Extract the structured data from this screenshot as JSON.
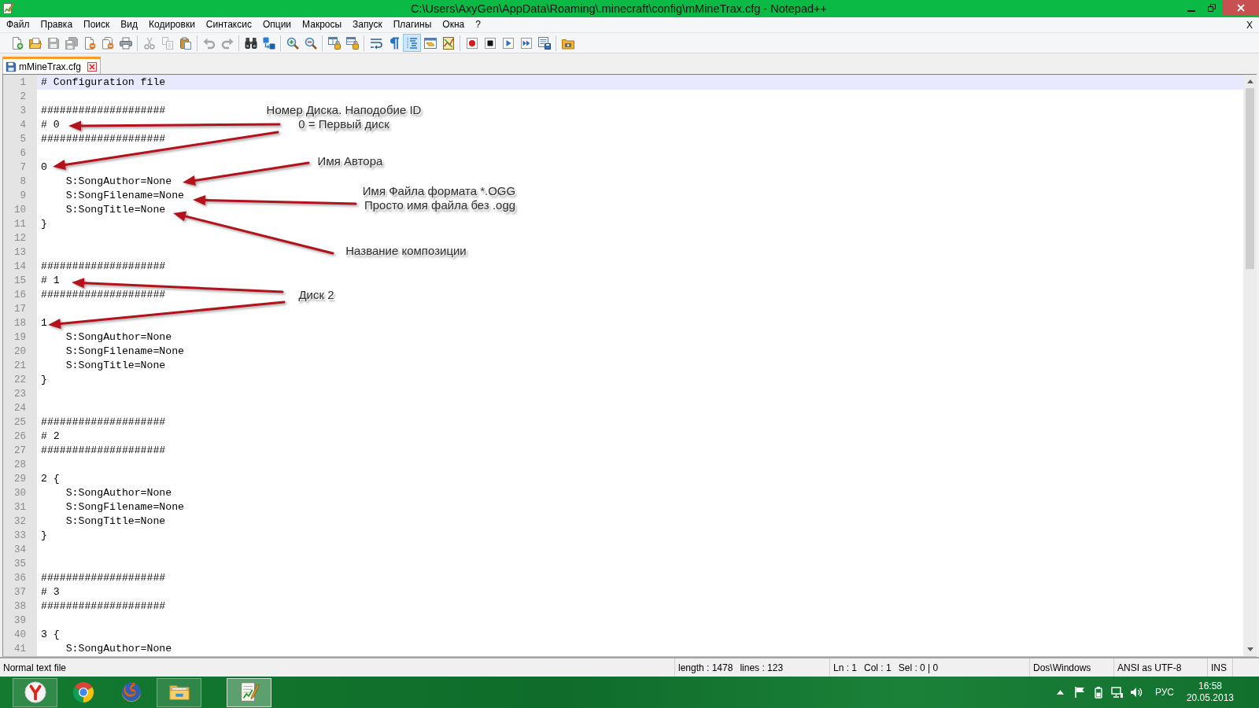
{
  "window": {
    "title": "C:\\Users\\AxyGen\\AppData\\Roaming\\.minecraft\\config\\mMineTrax.cfg - Notepad++"
  },
  "menu": [
    "Файл",
    "Правка",
    "Поиск",
    "Вид",
    "Кодировки",
    "Синтаксис",
    "Опции",
    "Макросы",
    "Запуск",
    "Плагины",
    "Окна",
    "?"
  ],
  "menu_close": "X",
  "toolbar": [
    [
      {
        "kind": "new",
        "disabled": false,
        "pressed": false
      },
      {
        "kind": "open",
        "disabled": false,
        "pressed": false
      },
      {
        "kind": "save",
        "disabled": true,
        "pressed": false
      },
      {
        "kind": "save_all",
        "disabled": true,
        "pressed": false
      },
      {
        "kind": "close",
        "disabled": false,
        "pressed": false
      },
      {
        "kind": "close_all",
        "disabled": false,
        "pressed": false
      },
      {
        "kind": "print",
        "disabled": false,
        "pressed": false
      }
    ],
    [
      {
        "kind": "cut",
        "disabled": true,
        "pressed": false
      },
      {
        "kind": "copy",
        "disabled": true,
        "pressed": false
      },
      {
        "kind": "paste",
        "disabled": false,
        "pressed": false
      }
    ],
    [
      {
        "kind": "undo",
        "disabled": true,
        "pressed": false
      },
      {
        "kind": "redo",
        "disabled": true,
        "pressed": false
      }
    ],
    [
      {
        "kind": "find",
        "disabled": false,
        "pressed": false
      },
      {
        "kind": "replace",
        "disabled": false,
        "pressed": false
      }
    ],
    [
      {
        "kind": "zoom_in",
        "disabled": false,
        "pressed": false
      },
      {
        "kind": "zoom_out",
        "disabled": false,
        "pressed": false
      }
    ],
    [
      {
        "kind": "sync_v",
        "disabled": false,
        "pressed": false
      },
      {
        "kind": "sync_h",
        "disabled": false,
        "pressed": false
      }
    ],
    [
      {
        "kind": "wrap",
        "disabled": false,
        "pressed": false
      },
      {
        "kind": "all_chars",
        "disabled": false,
        "pressed": false
      },
      {
        "kind": "indent_guide",
        "disabled": false,
        "pressed": true
      },
      {
        "kind": "udl",
        "disabled": false,
        "pressed": false
      },
      {
        "kind": "doc_map",
        "disabled": false,
        "pressed": false
      }
    ],
    [
      {
        "kind": "record",
        "disabled": false,
        "pressed": false
      },
      {
        "kind": "stop",
        "disabled": false,
        "pressed": false
      },
      {
        "kind": "play",
        "disabled": false,
        "pressed": false
      },
      {
        "kind": "play_multi",
        "disabled": false,
        "pressed": false
      },
      {
        "kind": "save_macro",
        "disabled": false,
        "pressed": false
      }
    ],
    [
      {
        "kind": "folder",
        "disabled": false,
        "pressed": false
      }
    ]
  ],
  "tabs": [
    {
      "label": "mMineTrax.cfg",
      "selected": true
    }
  ],
  "editor": {
    "lines": [
      {
        "number": "1",
        "text": "# Configuration file",
        "current": true
      },
      {
        "number": "2",
        "current": false
      },
      {
        "number": "3",
        "text": "####################",
        "current": false
      },
      {
        "number": "4",
        "text": "# 0",
        "current": false
      },
      {
        "number": "5",
        "text": "####################",
        "current": false
      },
      {
        "number": "6",
        "current": false
      },
      {
        "number": "7",
        "text": "0",
        "current": false
      },
      {
        "number": "8",
        "text": "    S:SongAuthor=None",
        "current": false
      },
      {
        "number": "9",
        "text": "    S:SongFilename=None",
        "current": false
      },
      {
        "number": "10",
        "text": "    S:SongTitle=None",
        "current": false
      },
      {
        "number": "11",
        "text": "}",
        "current": false
      },
      {
        "number": "12",
        "current": false
      },
      {
        "number": "13",
        "current": false
      },
      {
        "number": "14",
        "text": "####################",
        "current": false
      },
      {
        "number": "15",
        "text": "# 1",
        "current": false
      },
      {
        "number": "16",
        "text": "####################",
        "current": false
      },
      {
        "number": "17",
        "current": false
      },
      {
        "number": "18",
        "text": "1",
        "current": false
      },
      {
        "number": "19",
        "text": "    S:SongAuthor=None",
        "current": false
      },
      {
        "number": "20",
        "text": "    S:SongFilename=None",
        "current": false
      },
      {
        "number": "21",
        "text": "    S:SongTitle=None",
        "current": false
      },
      {
        "number": "22",
        "text": "}",
        "current": false
      },
      {
        "number": "23",
        "current": false
      },
      {
        "number": "24",
        "current": false
      },
      {
        "number": "25",
        "text": "####################",
        "current": false
      },
      {
        "number": "26",
        "text": "# 2",
        "current": false
      },
      {
        "number": "27",
        "text": "####################",
        "current": false
      },
      {
        "number": "28",
        "current": false
      },
      {
        "number": "29",
        "text": "2 {",
        "current": false
      },
      {
        "number": "30",
        "text": "    S:SongAuthor=None",
        "current": false
      },
      {
        "number": "31",
        "text": "    S:SongFilename=None",
        "current": false
      },
      {
        "number": "32",
        "text": "    S:SongTitle=None",
        "current": false
      },
      {
        "number": "33",
        "text": "}",
        "current": false
      },
      {
        "number": "34",
        "current": false
      },
      {
        "number": "35",
        "current": false
      },
      {
        "number": "36",
        "text": "####################",
        "current": false
      },
      {
        "number": "37",
        "text": "# 3",
        "current": false
      },
      {
        "number": "38",
        "text": "####################",
        "current": false
      },
      {
        "number": "39",
        "current": false
      },
      {
        "number": "40",
        "text": "3 {",
        "current": false
      },
      {
        "number": "41",
        "text": "    S:SongAuthor=None",
        "current": false
      }
    ]
  },
  "annotations": [
    {
      "text": "Номер Диска. Наподобие ID"
    },
    {
      "text": "0 = Первый диск"
    },
    {
      "text": "Имя Автора"
    },
    {
      "text": "Имя Файла формата *.OGG"
    },
    {
      "text": "Просто имя файла без .ogg"
    },
    {
      "text": "Название композиции"
    },
    {
      "text": "Диск 2"
    }
  ],
  "status_bar": {
    "file_type": "Normal text file",
    "length": "length : 1478",
    "lines": "lines : 123",
    "ln": "Ln : 1",
    "col": "Col : 1",
    "sel": "Sel : 0 | 0",
    "eol": "Dos\\Windows",
    "encoding": "ANSI as UTF-8",
    "mode": "INS"
  },
  "taskbar": {
    "apps": [
      {
        "kind": "y_browser",
        "running": true,
        "active": false
      },
      {
        "kind": "ring_browser",
        "running": false,
        "active": false
      },
      {
        "kind": "globe_browser",
        "running": false,
        "active": false
      },
      {
        "kind": "folder",
        "running": true,
        "active": false
      },
      {
        "kind": "notepad",
        "running": true,
        "active": true
      }
    ],
    "tray": {
      "language": "РУС",
      "time": "16:58",
      "date": "20.05.2013"
    }
  }
}
